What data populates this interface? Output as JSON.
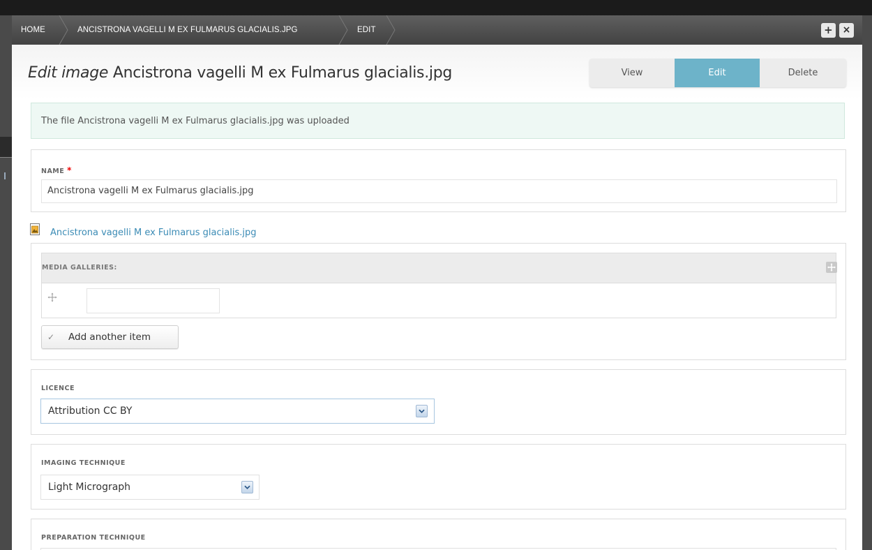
{
  "breadcrumbs": [
    {
      "label": "HOME"
    },
    {
      "label": "ANCISTRONA VAGELLI M EX FULMARUS GLACIALIS.JPG"
    },
    {
      "label": "EDIT"
    }
  ],
  "toolbar": {
    "add_glyph": "+",
    "close_glyph": "×",
    "add_icon": "plus-icon",
    "close_icon": "close-icon"
  },
  "header": {
    "title_prefix": "Edit image",
    "title_name": "Ancistrona vagelli M ex Fulmarus glacialis.jpg",
    "tabs": [
      {
        "label": "View",
        "active": false
      },
      {
        "label": "Edit",
        "active": true
      },
      {
        "label": "Delete",
        "active": false
      }
    ]
  },
  "status": {
    "message": "The file Ancistrona vagelli M ex Fulmarus glacialis.jpg was uploaded"
  },
  "name_field": {
    "label": "NAME",
    "required_mark": "*",
    "value": "Ancistrona vagelli M ex Fulmarus glacialis.jpg"
  },
  "file": {
    "link_text": "Ancistrona vagelli M ex Fulmarus glacialis.jpg",
    "icon": "image-file-icon"
  },
  "media_galleries": {
    "label": "MEDIA GALLERIES",
    "label_suffix": ":",
    "row_value": "",
    "add_button": "Add another item",
    "add_glyph": "✓"
  },
  "licence": {
    "label": "LICENCE",
    "selected": "Attribution CC BY"
  },
  "imaging_technique": {
    "label": "IMAGING TECHNIQUE",
    "selected": "Light Micrograph"
  },
  "preparation_technique": {
    "label": "PREPARATION TECHNIQUE"
  },
  "colors": {
    "accent": "#6db3c9",
    "link": "#3b8bb5",
    "status_bg": "#eef8f4",
    "toolbar": "#4a4a4a"
  }
}
